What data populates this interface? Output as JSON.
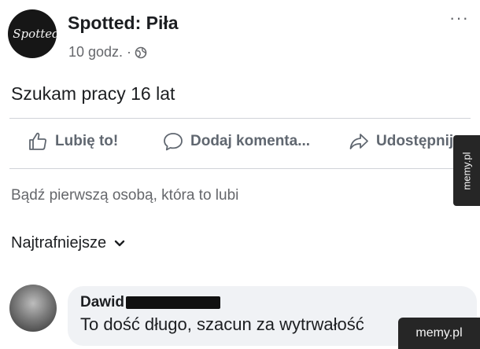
{
  "post": {
    "page_name": "Spotted: Piła",
    "avatar_text": "Spotted",
    "time": "10 godz. ·",
    "more": "···",
    "text": "Szukam pracy 16 lat"
  },
  "actions": {
    "like": "Lubię to!",
    "comment": "Dodaj komenta...",
    "share": "Udostępnij"
  },
  "likes_text": "Bądź pierwszą osobą, która to lubi",
  "sort_label": "Najtrafniejsze",
  "comment": {
    "author": "Dawid",
    "text": "To dość długo, szacun za wytrwałość"
  },
  "watermark": {
    "side": "memy.pl",
    "bottom": "memy.pl"
  },
  "icons": [
    "globe-icon",
    "like-icon",
    "comment-icon",
    "share-icon",
    "chevron-down-icon",
    "more-icon"
  ]
}
